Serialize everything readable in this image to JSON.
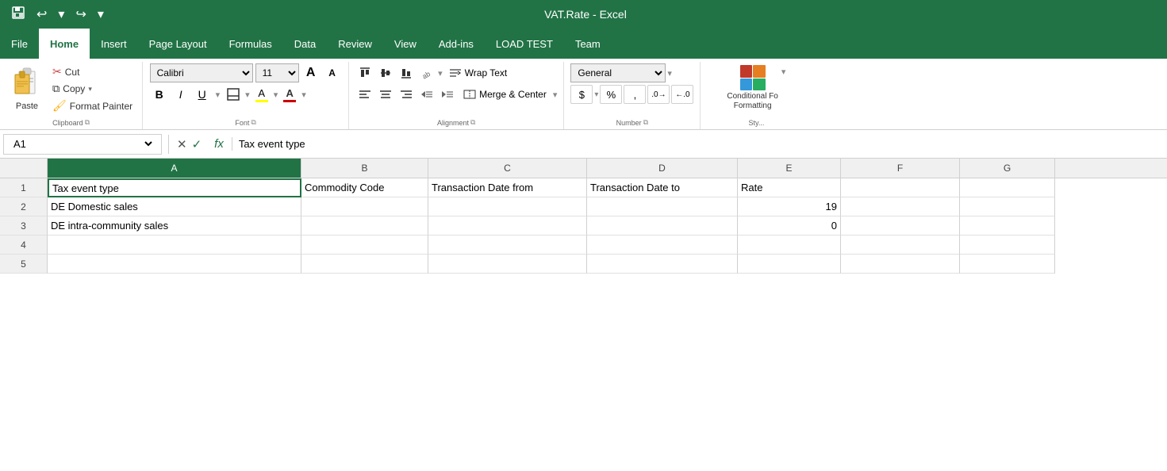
{
  "titleBar": {
    "title": "VAT.Rate - Excel",
    "saveIcon": "💾",
    "undoIcon": "↩",
    "redoIcon": "↪"
  },
  "menuBar": {
    "items": [
      {
        "id": "file",
        "label": "File"
      },
      {
        "id": "home",
        "label": "Home",
        "active": true
      },
      {
        "id": "insert",
        "label": "Insert"
      },
      {
        "id": "page-layout",
        "label": "Page Layout"
      },
      {
        "id": "formulas",
        "label": "Formulas"
      },
      {
        "id": "data",
        "label": "Data"
      },
      {
        "id": "review",
        "label": "Review"
      },
      {
        "id": "view",
        "label": "View"
      },
      {
        "id": "add-ins",
        "label": "Add-ins"
      },
      {
        "id": "load-test",
        "label": "LOAD TEST"
      },
      {
        "id": "team",
        "label": "Team"
      }
    ]
  },
  "ribbon": {
    "groups": {
      "clipboard": {
        "label": "Clipboard",
        "pasteLabel": "Paste",
        "cutLabel": "Cut",
        "copyLabel": "Copy",
        "formatPainterLabel": "Format Painter"
      },
      "font": {
        "label": "Font",
        "fontName": "Calibri",
        "fontSize": "11",
        "boldLabel": "B",
        "italicLabel": "I",
        "underlineLabel": "U",
        "growLabel": "A",
        "shrinkLabel": "A"
      },
      "alignment": {
        "label": "Alignment",
        "wrapText": "Wrap Text",
        "mergeCenter": "Merge & Center"
      },
      "number": {
        "label": "Number",
        "format": "General",
        "dollarSign": "$",
        "percentSign": "%",
        "commaSign": ","
      },
      "styles": {
        "label": "Styles",
        "conditionalFormatting": "Conditional Fo",
        "formatting": "Formatting",
        "arrow": "▼"
      }
    }
  },
  "formulaBar": {
    "cellRef": "A1",
    "formula": "Tax event type"
  },
  "spreadsheet": {
    "columns": [
      {
        "id": "A",
        "label": "A",
        "selected": true
      },
      {
        "id": "B",
        "label": "B"
      },
      {
        "id": "C",
        "label": "C"
      },
      {
        "id": "D",
        "label": "D"
      },
      {
        "id": "E",
        "label": "E"
      },
      {
        "id": "F",
        "label": "F"
      },
      {
        "id": "G",
        "label": "G"
      }
    ],
    "rows": [
      {
        "rowNum": "1",
        "cells": [
          {
            "col": "A",
            "value": "Tax event type",
            "selected": true
          },
          {
            "col": "B",
            "value": "Commodity Code"
          },
          {
            "col": "C",
            "value": "Transaction Date from"
          },
          {
            "col": "D",
            "value": "Transaction Date to"
          },
          {
            "col": "E",
            "value": "Rate"
          },
          {
            "col": "F",
            "value": ""
          },
          {
            "col": "G",
            "value": ""
          }
        ]
      },
      {
        "rowNum": "2",
        "cells": [
          {
            "col": "A",
            "value": "DE Domestic sales"
          },
          {
            "col": "B",
            "value": ""
          },
          {
            "col": "C",
            "value": ""
          },
          {
            "col": "D",
            "value": ""
          },
          {
            "col": "E",
            "value": "19",
            "isNumber": true
          },
          {
            "col": "F",
            "value": ""
          },
          {
            "col": "G",
            "value": ""
          }
        ]
      },
      {
        "rowNum": "3",
        "cells": [
          {
            "col": "A",
            "value": "DE intra-community sales"
          },
          {
            "col": "B",
            "value": ""
          },
          {
            "col": "C",
            "value": ""
          },
          {
            "col": "D",
            "value": ""
          },
          {
            "col": "E",
            "value": "0",
            "isNumber": true
          },
          {
            "col": "F",
            "value": ""
          },
          {
            "col": "G",
            "value": ""
          }
        ]
      },
      {
        "rowNum": "4",
        "cells": [
          {
            "col": "A",
            "value": ""
          },
          {
            "col": "B",
            "value": ""
          },
          {
            "col": "C",
            "value": ""
          },
          {
            "col": "D",
            "value": ""
          },
          {
            "col": "E",
            "value": ""
          },
          {
            "col": "F",
            "value": ""
          },
          {
            "col": "G",
            "value": ""
          }
        ]
      },
      {
        "rowNum": "5",
        "cells": [
          {
            "col": "A",
            "value": ""
          },
          {
            "col": "B",
            "value": ""
          },
          {
            "col": "C",
            "value": ""
          },
          {
            "col": "D",
            "value": ""
          },
          {
            "col": "E",
            "value": ""
          },
          {
            "col": "F",
            "value": ""
          },
          {
            "col": "G",
            "value": ""
          }
        ]
      }
    ]
  }
}
